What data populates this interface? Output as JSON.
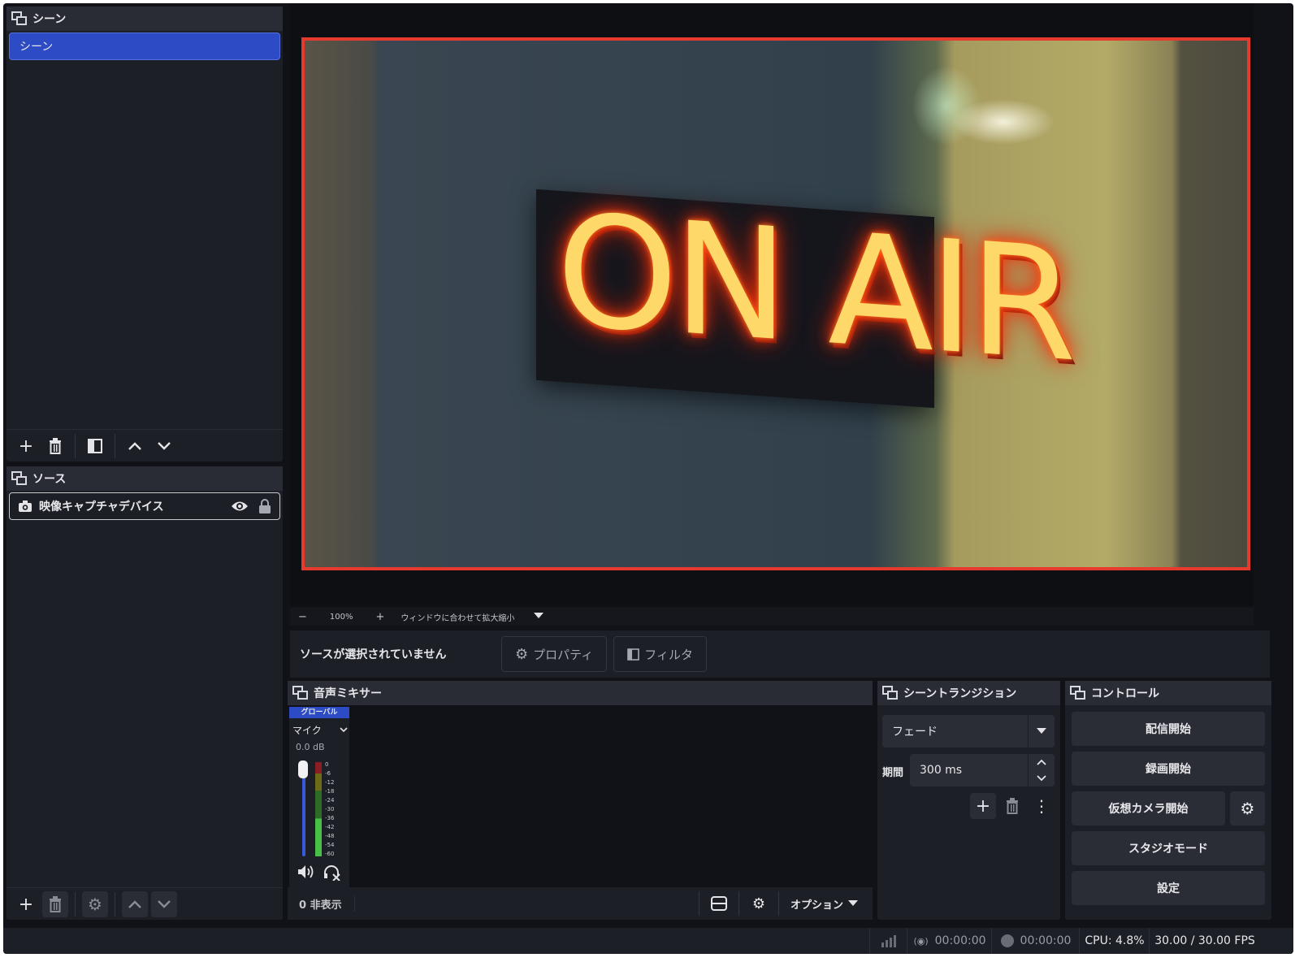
{
  "scenes": {
    "title": "シーン",
    "items": [
      {
        "label": "シーン"
      }
    ]
  },
  "sources": {
    "title": "ソース",
    "items": [
      {
        "label": "映像キャプチャデバイス"
      }
    ]
  },
  "preview": {
    "neon_text": "ON AIR",
    "zoom_minus": "−",
    "zoom_level": "100%",
    "zoom_plus": "+",
    "zoom_fit": "ウィンドウに合わせて拡大縮小"
  },
  "context_bar": {
    "no_source": "ソースが選択されていません",
    "properties": "プロパティ",
    "filters": "フィルタ"
  },
  "mixer": {
    "title": "音声ミキサー",
    "global_badge": "グローバル",
    "channel_name": "マイク",
    "level": "0.0 dB",
    "scale": [
      "0",
      "-6",
      "-12",
      "-18",
      "-24",
      "-30",
      "-36",
      "-42",
      "-48",
      "-54",
      "-60"
    ],
    "hidden_count": "0 非表示",
    "options": "オプション"
  },
  "transitions": {
    "title": "シーントランジション",
    "selected": "フェード",
    "duration_label": "期間",
    "duration_value": "300 ms"
  },
  "controls": {
    "title": "コントロール",
    "start_stream": "配信開始",
    "start_recording": "録画開始",
    "start_virtual_cam": "仮想カメラ開始",
    "studio_mode": "スタジオモード",
    "settings": "設定"
  },
  "status_bar": {
    "stream_time": "00:00:00",
    "record_time": "00:00:00",
    "cpu": "CPU: 4.8%",
    "fps": "30.00 / 30.00 FPS"
  },
  "colors": {
    "selected": "#2c4bc4",
    "recording_border": "#e63a2e",
    "background": "#111218",
    "panel": "#1d1f26"
  }
}
